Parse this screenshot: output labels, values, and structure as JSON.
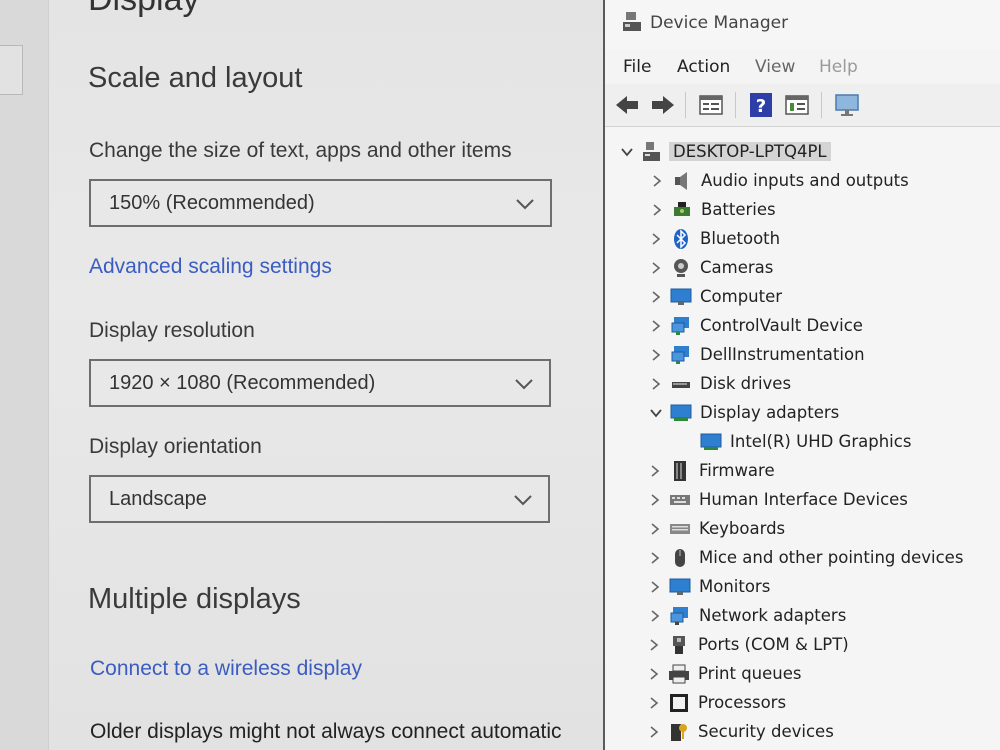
{
  "settings": {
    "page_title": "Display",
    "scale_section": "Scale and layout",
    "scale_label": "Change the size of text, apps and other items",
    "scale_value": "150% (Recommended)",
    "advanced_link": "Advanced scaling settings",
    "resolution_label": "Display resolution",
    "resolution_value": "1920 × 1080 (Recommended)",
    "orientation_label": "Display orientation",
    "orientation_value": "Landscape",
    "multiple_section": "Multiple displays",
    "wireless_link": "Connect to a wireless display",
    "older_text": "Older displays might not always connect automatic"
  },
  "device_manager": {
    "title": "Device Manager",
    "menu": [
      "File",
      "Action",
      "View",
      "Help"
    ],
    "toolbar_icons": [
      "back-arrow-icon",
      "forward-arrow-icon",
      "properties-icon",
      "help-icon",
      "update-driver-icon",
      "monitor-icon"
    ],
    "root": "DESKTOP-LPTQ4PL",
    "categories": [
      {
        "label": "Audio inputs and outputs",
        "icon": "speaker-icon",
        "expanded": false
      },
      {
        "label": "Batteries",
        "icon": "battery-icon",
        "expanded": false
      },
      {
        "label": "Bluetooth",
        "icon": "bluetooth-icon",
        "expanded": false
      },
      {
        "label": "Cameras",
        "icon": "camera-icon",
        "expanded": false
      },
      {
        "label": "Computer",
        "icon": "computer-icon",
        "expanded": false
      },
      {
        "label": "ControlVault Device",
        "icon": "network-device-icon",
        "expanded": false
      },
      {
        "label": "DellInstrumentation",
        "icon": "network-device-icon",
        "expanded": false
      },
      {
        "label": "Disk drives",
        "icon": "disk-drive-icon",
        "expanded": false
      },
      {
        "label": "Display adapters",
        "icon": "display-adapter-icon",
        "expanded": true,
        "children": [
          "Intel(R) UHD Graphics"
        ]
      },
      {
        "label": "Firmware",
        "icon": "firmware-icon",
        "expanded": false
      },
      {
        "label": "Human Interface Devices",
        "icon": "hid-icon",
        "expanded": false
      },
      {
        "label": "Keyboards",
        "icon": "keyboard-icon",
        "expanded": false
      },
      {
        "label": "Mice and other pointing devices",
        "icon": "mouse-icon",
        "expanded": false
      },
      {
        "label": "Monitors",
        "icon": "monitor-icon",
        "expanded": false
      },
      {
        "label": "Network adapters",
        "icon": "network-adapter-icon",
        "expanded": false
      },
      {
        "label": "Ports (COM & LPT)",
        "icon": "port-icon",
        "expanded": false
      },
      {
        "label": "Print queues",
        "icon": "printer-icon",
        "expanded": false
      },
      {
        "label": "Processors",
        "icon": "processor-icon",
        "expanded": false
      },
      {
        "label": "Security devices",
        "icon": "security-device-icon",
        "expanded": false
      }
    ]
  },
  "colors": {
    "link": "#3b5cc0",
    "selection": "#d4d4d4",
    "monitor_blue": "#2f7fd0"
  }
}
